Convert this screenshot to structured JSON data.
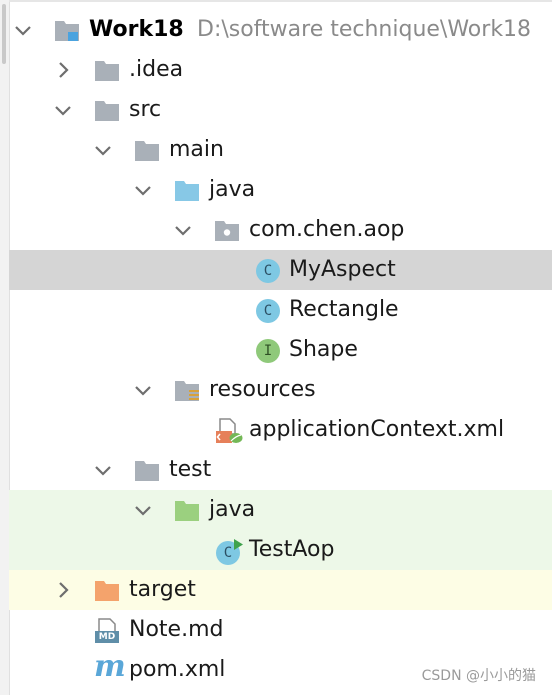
{
  "project": {
    "name": "Work18",
    "path": "D:\\software technique\\Work18"
  },
  "tree": {
    "idea": ".idea",
    "src": "src",
    "main": "main",
    "main_java": "java",
    "package": "com.chen.aop",
    "my_aspect": "MyAspect",
    "rectangle": "Rectangle",
    "shape": "Shape",
    "resources": "resources",
    "app_context": "applicationContext.xml",
    "test": "test",
    "test_java": "java",
    "test_aop": "TestAop",
    "target": "target",
    "note": "Note.md",
    "pom": "pom.xml"
  },
  "badges": {
    "class": "C",
    "interface": "I",
    "markdown": "MD",
    "maven": "m"
  },
  "watermark": "CSDN @小小的猫",
  "colors": {
    "folder_gray": "#a9b0b8",
    "folder_source_blue": "#87c8e6",
    "folder_test_green": "#9bd07f",
    "folder_excluded_orange": "#f4a36c",
    "class_badge": "#7ec8e3",
    "interface_badge": "#8fc97a",
    "selected_row": "#d5d5d5",
    "test_row": "#edf8e8",
    "excluded_row": "#fdfde5"
  }
}
